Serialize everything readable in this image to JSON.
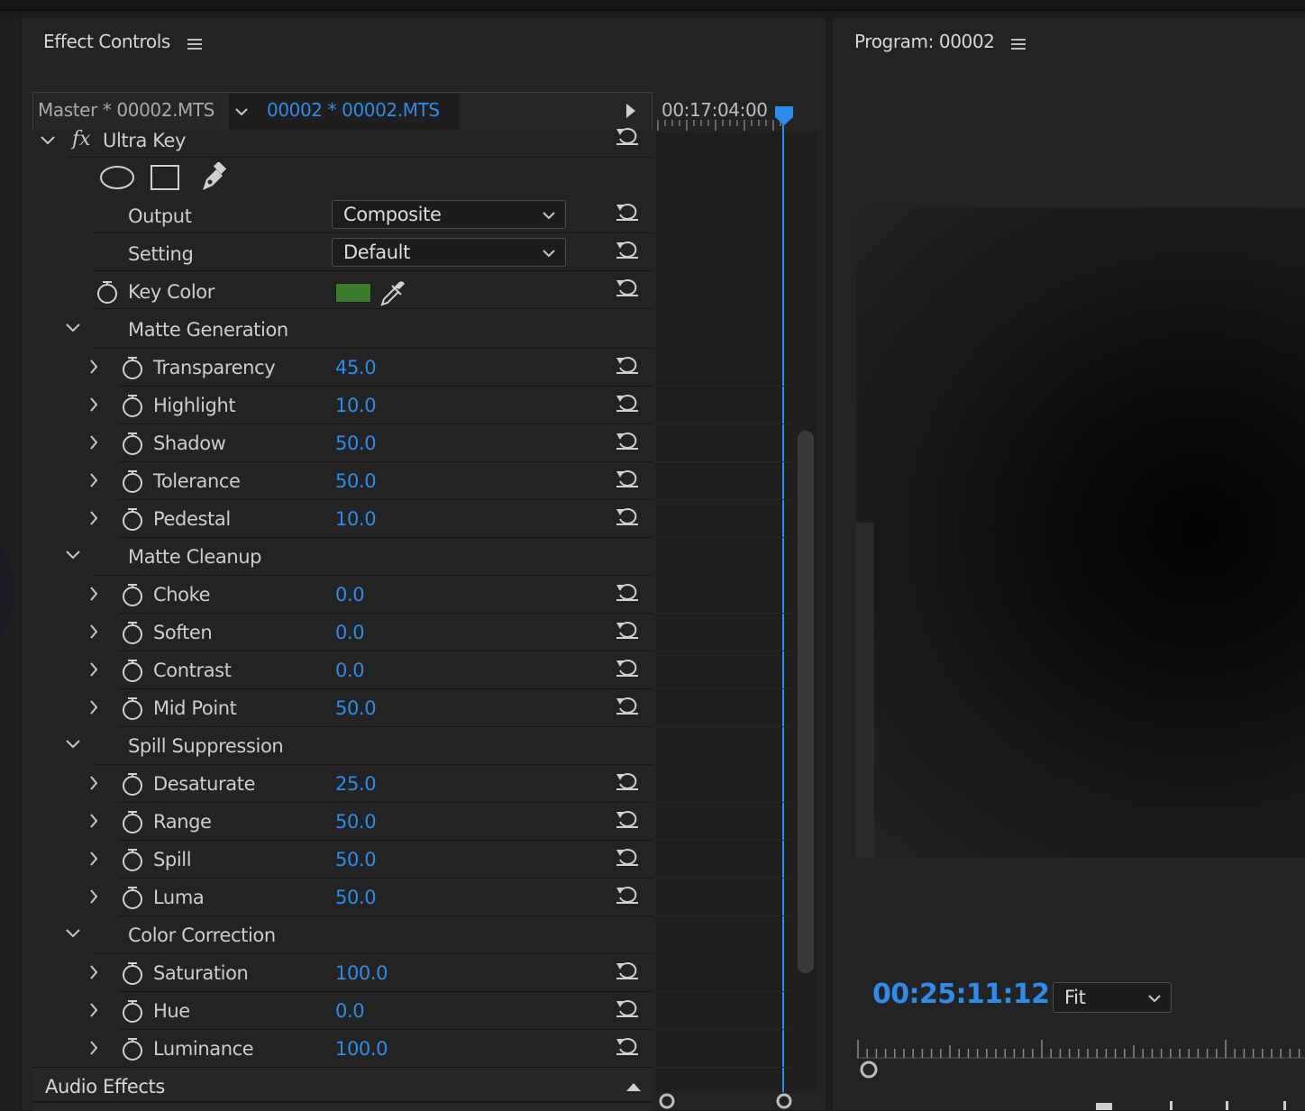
{
  "effect_controls": {
    "title": "Effect Controls",
    "tab_master": "Master * 00002.MTS",
    "tab_clip": "00002 * 00002.MTS",
    "timecode": "00:17:04:00",
    "effect_name": "Ultra Key",
    "fx_glyph": "fx",
    "output": {
      "label": "Output",
      "value": "Composite"
    },
    "setting": {
      "label": "Setting",
      "value": "Default"
    },
    "key_color": {
      "label": "Key Color",
      "swatch": "#3c7a2c"
    },
    "groups": [
      {
        "name": "Matte Generation",
        "params": [
          {
            "label": "Transparency",
            "value": "45.0"
          },
          {
            "label": "Highlight",
            "value": "10.0"
          },
          {
            "label": "Shadow",
            "value": "50.0"
          },
          {
            "label": "Tolerance",
            "value": "50.0"
          },
          {
            "label": "Pedestal",
            "value": "10.0"
          }
        ]
      },
      {
        "name": "Matte Cleanup",
        "params": [
          {
            "label": "Choke",
            "value": "0.0"
          },
          {
            "label": "Soften",
            "value": "0.0"
          },
          {
            "label": "Contrast",
            "value": "0.0"
          },
          {
            "label": "Mid Point",
            "value": "50.0"
          }
        ]
      },
      {
        "name": "Spill Suppression",
        "params": [
          {
            "label": "Desaturate",
            "value": "25.0"
          },
          {
            "label": "Range",
            "value": "50.0"
          },
          {
            "label": "Spill",
            "value": "50.0"
          },
          {
            "label": "Luma",
            "value": "50.0"
          }
        ]
      },
      {
        "name": "Color Correction",
        "params": [
          {
            "label": "Saturation",
            "value": "100.0"
          },
          {
            "label": "Hue",
            "value": "0.0"
          },
          {
            "label": "Luminance",
            "value": "100.0"
          }
        ]
      }
    ],
    "audio_effects_label": "Audio Effects"
  },
  "program": {
    "title": "Program: 00002",
    "timecode": "00:25:11:12",
    "zoom": "Fit"
  },
  "colors": {
    "accent": "#2d8ceb"
  }
}
